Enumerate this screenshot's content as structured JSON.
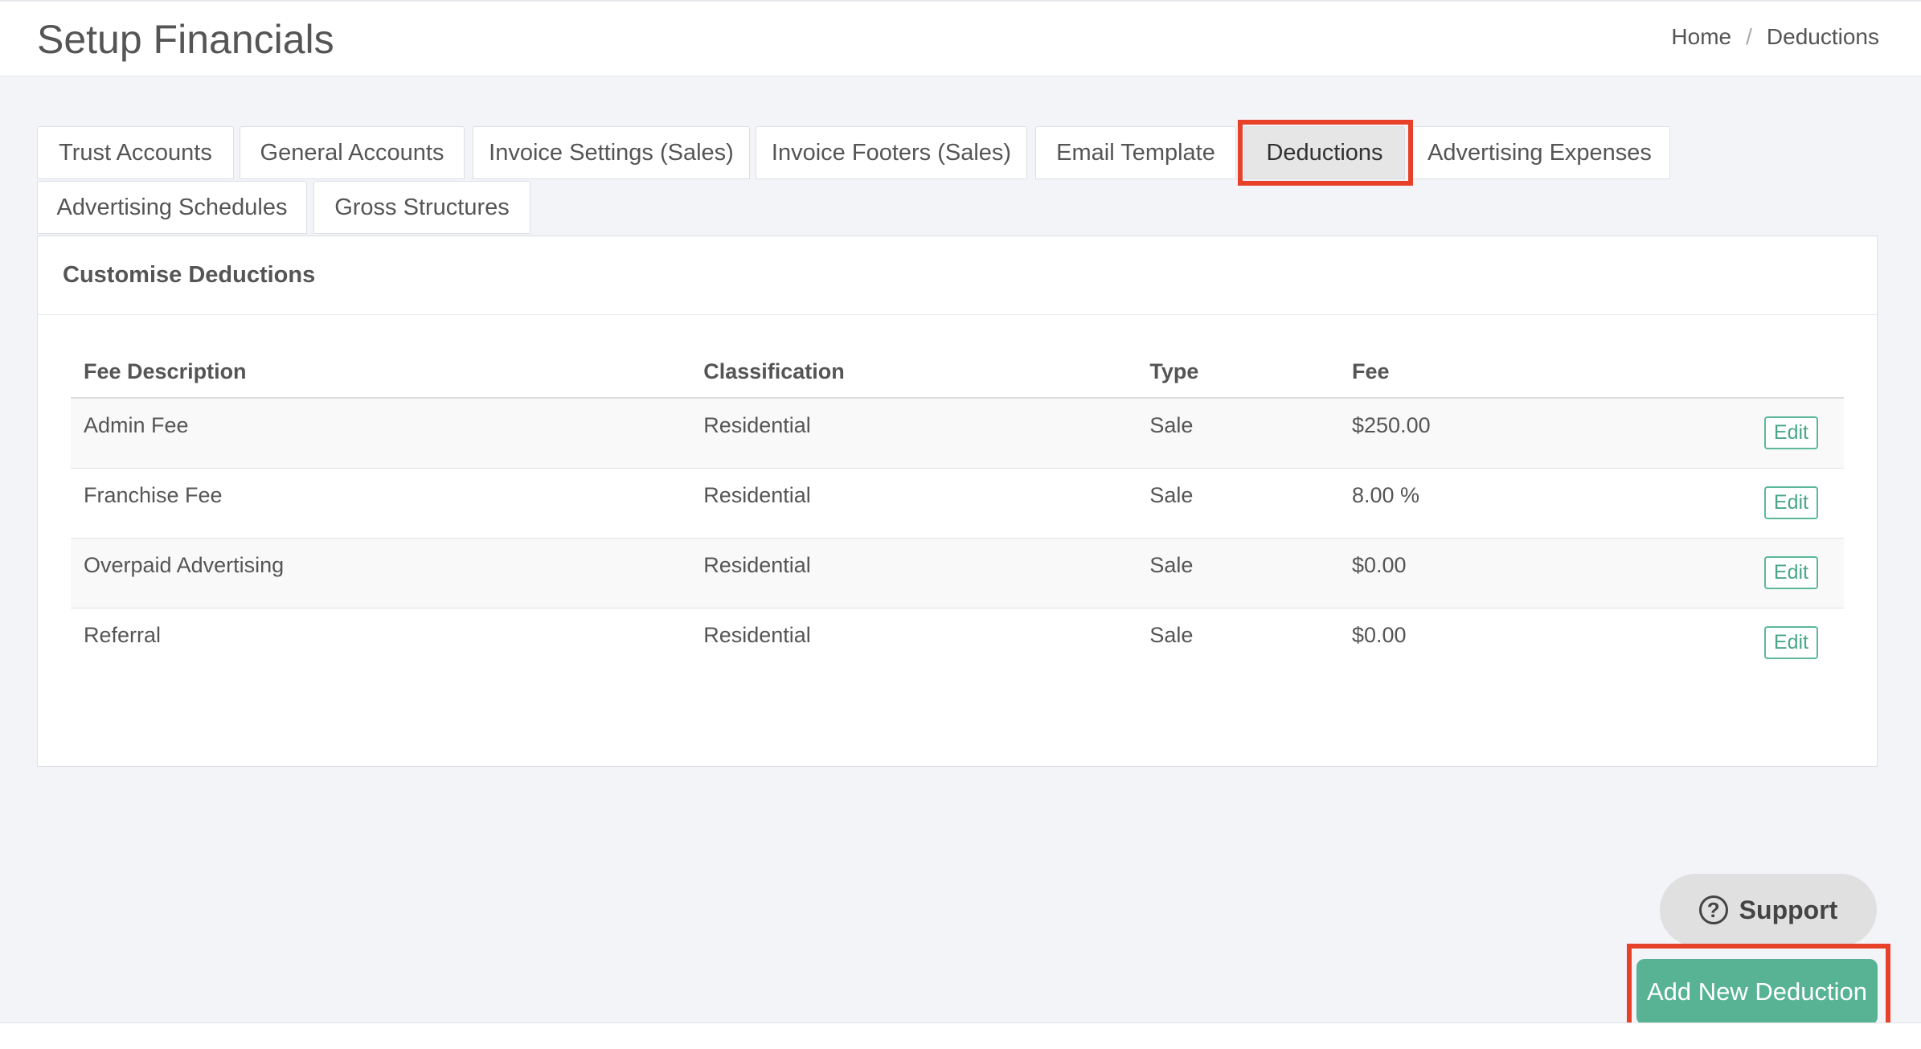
{
  "header": {
    "title": "Setup Financials",
    "breadcrumb": {
      "home": "Home",
      "separator": "/",
      "current": "Deductions"
    }
  },
  "tabs": [
    {
      "label": "Trust Accounts"
    },
    {
      "label": "General Accounts"
    },
    {
      "label": "Invoice Settings (Sales)"
    },
    {
      "label": "Invoice Footers (Sales)"
    },
    {
      "label": "Email Template"
    },
    {
      "label": "Deductions",
      "active": true
    },
    {
      "label": "Advertising Expenses"
    },
    {
      "label": "Advertising Schedules"
    },
    {
      "label": "Gross Structures"
    }
  ],
  "panel": {
    "heading": "Customise Deductions",
    "columns": {
      "description": "Fee Description",
      "classification": "Classification",
      "type": "Type",
      "fee": "Fee"
    },
    "rows": [
      {
        "description": "Admin Fee",
        "classification": "Residential",
        "type": "Sale",
        "fee": "$250.00",
        "action": "Edit"
      },
      {
        "description": "Franchise Fee",
        "classification": "Residential",
        "type": "Sale",
        "fee": "8.00 %",
        "action": "Edit"
      },
      {
        "description": "Overpaid Advertising",
        "classification": "Residential",
        "type": "Sale",
        "fee": "$0.00",
        "action": "Edit"
      },
      {
        "description": "Referral",
        "classification": "Residential",
        "type": "Sale",
        "fee": "$0.00",
        "action": "Edit"
      }
    ]
  },
  "support": {
    "label": "Support",
    "icon": "question-circle-icon"
  },
  "add_button": {
    "label": "Add New Deduction"
  },
  "colors": {
    "accent": "#57b393",
    "highlight": "#e8412a",
    "background": "#f3f4f8"
  }
}
